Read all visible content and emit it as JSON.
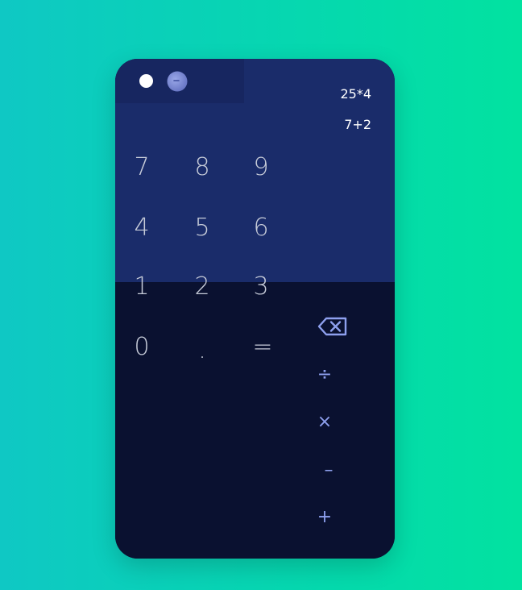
{
  "history": [
    "25*4",
    "7+2"
  ],
  "keys": {
    "k7": "7",
    "k8": "8",
    "k9": "9",
    "k4": "4",
    "k5": "5",
    "k6": "6",
    "k1": "1",
    "k2": "2",
    "k3": "3",
    "k0": "0",
    "kdot": ".",
    "keq": "="
  },
  "ops": {
    "divide": "÷",
    "multiply": "×",
    "subtract": "–",
    "add": "+"
  },
  "icons": {
    "theme_toggle": "toggle-dot",
    "theme_mode": "moon-icon",
    "delete": "backspace-icon"
  },
  "colors": {
    "display_bg": "#1a2c6a",
    "keypad_bg": "#0a1130",
    "operator": "#8ea0ee",
    "digit": "#c7ccd9"
  }
}
